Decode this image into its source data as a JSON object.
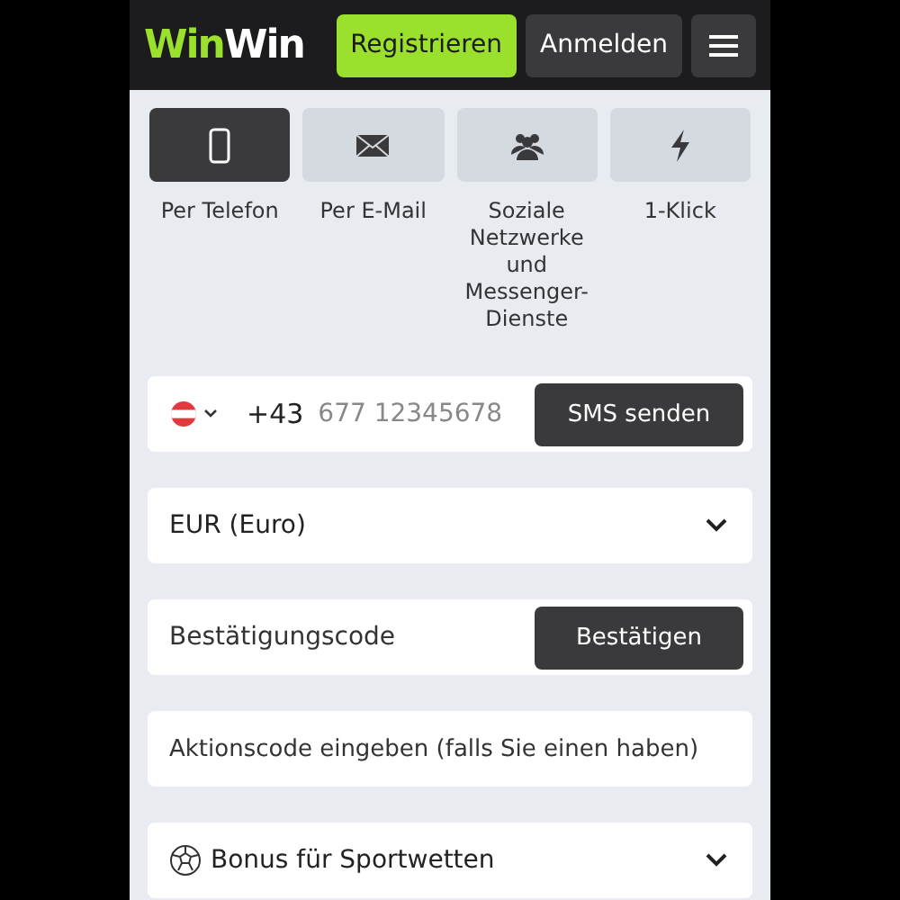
{
  "header": {
    "logo": [
      {
        "text": "Win",
        "kind": "accent"
      },
      {
        "text": "Win",
        "kind": "plain"
      }
    ],
    "register_button": "Registrieren",
    "login_button": "Anmelden"
  },
  "methods": [
    {
      "label": "Per Telefon",
      "kind": "phone",
      "selected": true
    },
    {
      "label": "Per E-Mail",
      "kind": "mail",
      "selected": false
    },
    {
      "label": "Soziale Netzwerke und Messenger-Dienste",
      "kind": "social",
      "selected": false
    },
    {
      "label": "1-Klick",
      "kind": "bolt",
      "selected": false
    }
  ],
  "phone": {
    "prefix": "+43",
    "placeholder": "677 12345678",
    "button": "SMS senden"
  },
  "currency": {
    "value": "EUR (Euro)"
  },
  "confirmation": {
    "placeholder": "Bestätigungscode",
    "button": "Bestätigen"
  },
  "promo": {
    "placeholder": "Aktionscode eingeben (falls Sie einen haben)"
  },
  "bonus": {
    "label": "Bonus für Sportwetten"
  }
}
